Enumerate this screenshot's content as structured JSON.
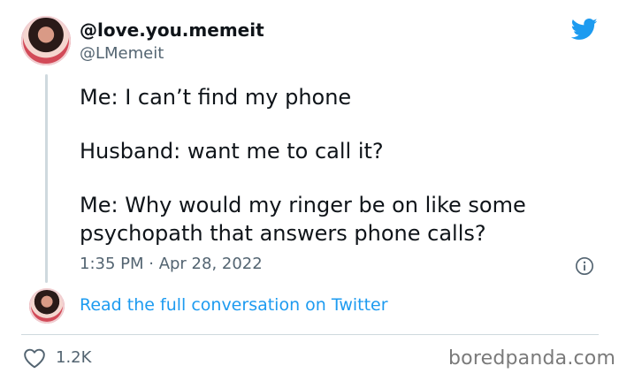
{
  "author": {
    "display_name": "@love.you.memeit",
    "handle": "@LMemeit"
  },
  "tweet": {
    "lines": [
      "Me: I can’t find my phone",
      "Husband: want me to call it?",
      "Me: Why would my ringer be on like some",
      "psychopath that answers phone calls?"
    ],
    "timestamp": "1:35 PM · Apr 28, 2022"
  },
  "conversation_link": "Read the full conversation on Twitter",
  "likes": "1.2K",
  "watermark": "boredpanda.com",
  "colors": {
    "twitter_blue": "#1d9bf0",
    "text_primary": "#0f1419",
    "text_secondary": "#536471",
    "divider": "#cfd9de"
  },
  "icons": [
    "twitter-bird-icon",
    "info-icon",
    "heart-icon"
  ]
}
